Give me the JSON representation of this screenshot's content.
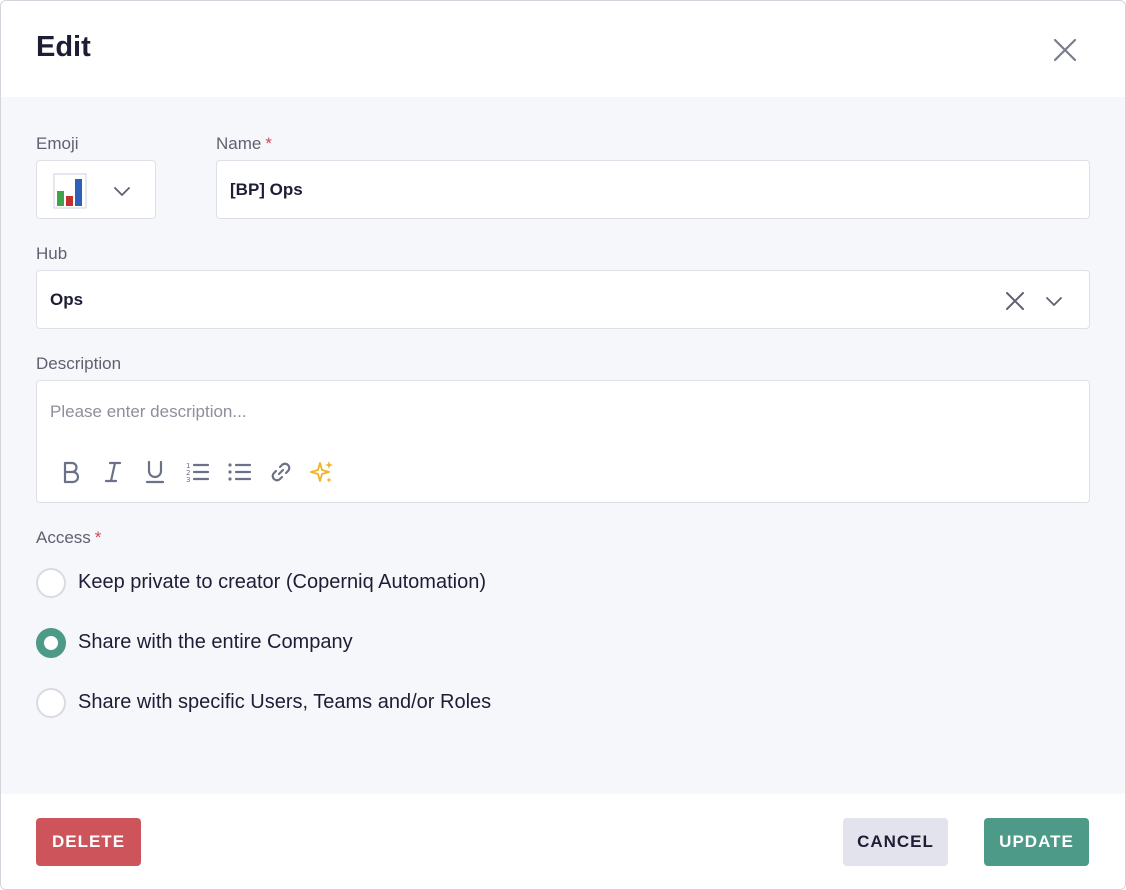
{
  "dialog": {
    "title": "Edit"
  },
  "form": {
    "emoji": {
      "label": "Emoji",
      "selected_icon": "bar-chart-emoji"
    },
    "name": {
      "label": "Name",
      "required_mark": "*",
      "value": "[BP] Ops"
    },
    "hub": {
      "label": "Hub",
      "value": "Ops"
    },
    "description": {
      "label": "Description",
      "placeholder": "Please enter description...",
      "toolbar": [
        "bold-icon",
        "italic-icon",
        "underline-icon",
        "numbered-list-icon",
        "bulleted-list-icon",
        "link-icon",
        "ai-sparkle-icon"
      ]
    },
    "access": {
      "label": "Access",
      "required_mark": "*",
      "options": [
        {
          "label": "Keep private to creator (Coperniq Automation)",
          "selected": false
        },
        {
          "label": "Share with the entire Company",
          "selected": true
        },
        {
          "label": "Share with specific Users, Teams and/or Roles",
          "selected": false
        }
      ]
    }
  },
  "footer": {
    "delete_label": "DELETE",
    "cancel_label": "CANCEL",
    "update_label": "UPDATE"
  },
  "colors": {
    "accent": "#4d9a89",
    "danger": "#cd545b",
    "required": "#d54855",
    "sparkle": "#f0b323"
  }
}
